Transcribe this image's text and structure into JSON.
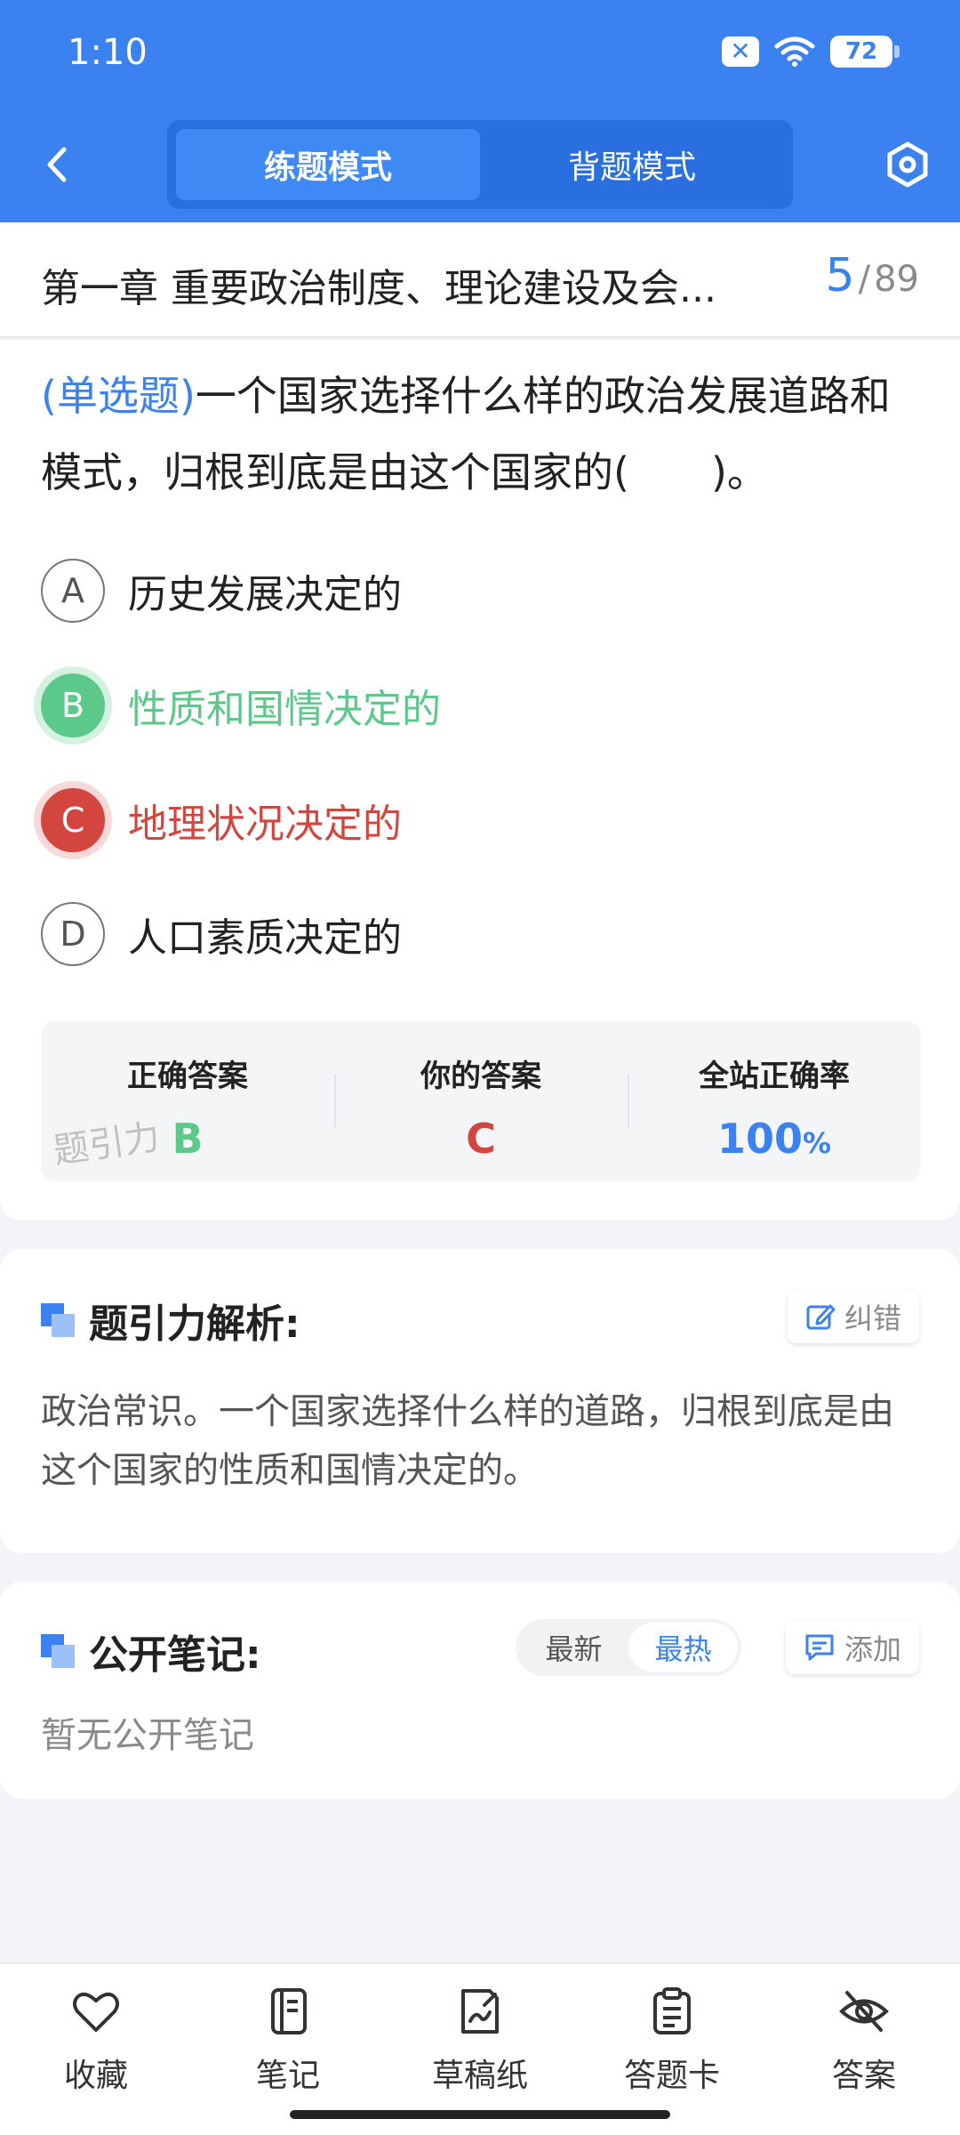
{
  "status": {
    "time": "1:10",
    "battery": "72"
  },
  "modes": {
    "practice": "练题模式",
    "memorize": "背题模式"
  },
  "header": {
    "chapter_title": "第一章 重要政治制度、理论建设及会...",
    "current": "5",
    "separator": "/",
    "total": "89"
  },
  "question": {
    "type": "(单选题)",
    "text": "一个国家选择什么样的政治发展道路和模式，归根到底是由这个国家的(　　)。",
    "options": [
      {
        "letter": "A",
        "text": "历史发展决定的",
        "state": "normal"
      },
      {
        "letter": "B",
        "text": "性质和国情决定的",
        "state": "correct"
      },
      {
        "letter": "C",
        "text": "地理状况决定的",
        "state": "wrong"
      },
      {
        "letter": "D",
        "text": "人口素质决定的",
        "state": "normal"
      }
    ]
  },
  "answer": {
    "correct_label": "正确答案",
    "correct_value": "B",
    "yours_label": "你的答案",
    "yours_value": "C",
    "rate_label": "全站正确率",
    "rate_value": "100",
    "rate_unit": "%"
  },
  "watermark": "题引力",
  "analysis": {
    "title": "题引力解析:",
    "report_label": "纠错",
    "text": "政治常识。一个国家选择什么样的道路，归根到底是由这个国家的性质和国情决定的。"
  },
  "notes": {
    "title": "公开笔记:",
    "sort_latest": "最新",
    "sort_hot": "最热",
    "add_label": "添加",
    "empty_text": "暂无公开笔记"
  },
  "bottom_nav": [
    {
      "label": "收藏",
      "icon": "heart-icon"
    },
    {
      "label": "笔记",
      "icon": "notebook-icon"
    },
    {
      "label": "草稿纸",
      "icon": "draft-icon"
    },
    {
      "label": "答题卡",
      "icon": "clipboard-icon"
    },
    {
      "label": "答案",
      "icon": "eye-off-icon"
    }
  ],
  "colors": {
    "primary": "#3b82f0",
    "correct": "#5cc98a",
    "wrong": "#d2463f"
  }
}
